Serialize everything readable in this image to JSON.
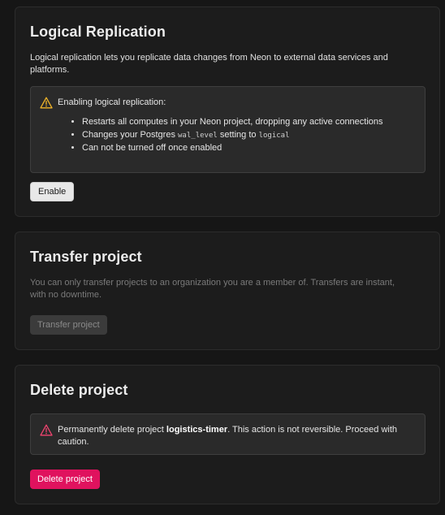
{
  "logical_replication": {
    "title": "Logical Replication",
    "description": "Logical replication lets you replicate data changes from Neon to external data services and platforms.",
    "callout": {
      "title": "Enabling logical replication:",
      "item1": "Restarts all computes in your Neon project, dropping any active connections",
      "item2_before": "Changes your Postgres ",
      "item2_code1": "wal_level",
      "item2_mid": " setting to ",
      "item2_code2": "logical",
      "item3": "Can not be turned off once enabled"
    },
    "button_label": "Enable"
  },
  "transfer_project": {
    "title": "Transfer project",
    "description": "You can only transfer projects to an organization you are a member of. Transfers are instant, with no downtime.",
    "button_label": "Transfer project"
  },
  "delete_project": {
    "title": "Delete project",
    "callout_before": "Permanently delete project ",
    "project_name": "logistics-timer",
    "callout_after": ". This action is not reversible. Proceed with caution.",
    "button_label": "Delete project"
  },
  "colors": {
    "danger": "#e0125e",
    "warning_icon": "#f0b429",
    "danger_icon": "#f0446f"
  },
  "icons": {
    "warning": "warning-triangle-icon",
    "danger": "danger-triangle-icon"
  }
}
